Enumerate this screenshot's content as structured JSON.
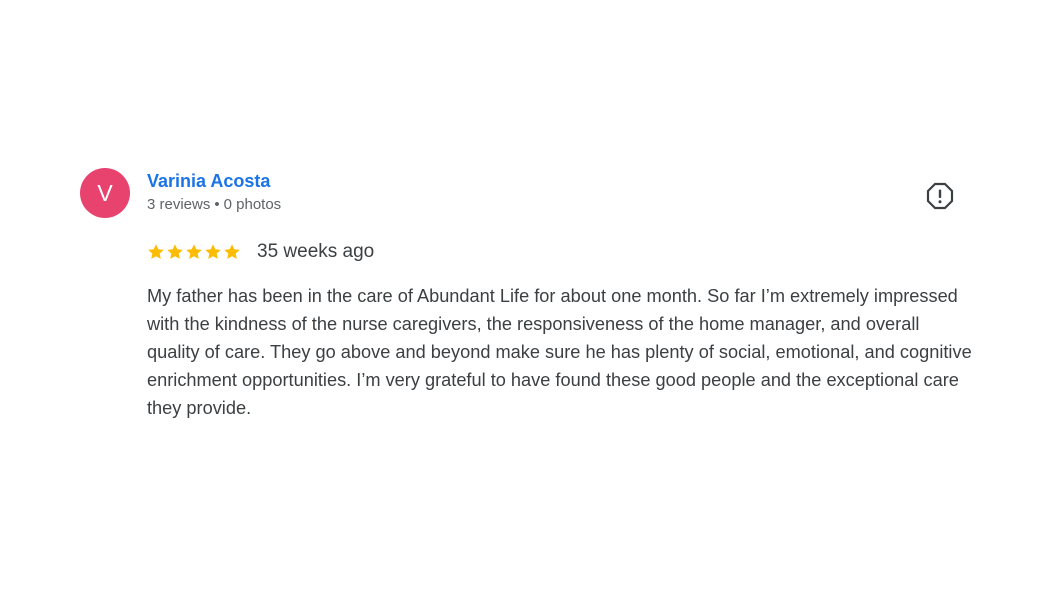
{
  "review": {
    "avatar_letter": "V",
    "avatar_color": "#e8436f",
    "author_name": "Varinia Acosta",
    "author_color": "#1a73e8",
    "reviews_count": "3 reviews",
    "separator": "•",
    "photos_count": "0 photos",
    "rating": 5,
    "rating_max": 5,
    "star_color": "#fbbc04",
    "time_ago": "35 weeks ago",
    "text": "My father has been in the care of Abundant Life for about one month. So far I’m extremely impressed with the kindness of the nurse caregivers, the responsiveness of the home manager, and overall quality of care. They go above and beyond make sure he has plenty of social, emotional, and cognitive enrichment opportunities. I’m very grateful to have found these good people and the exceptional care they provide."
  },
  "icons": {
    "flag": "report-flag-icon",
    "star": "star-icon"
  }
}
